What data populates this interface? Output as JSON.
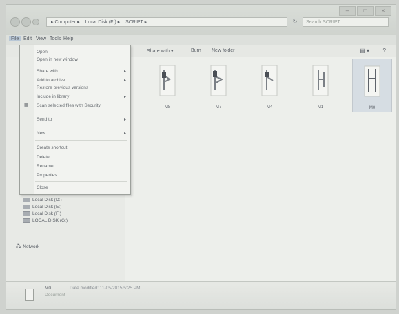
{
  "address": {
    "crumbs": [
      "▸ Computer ▸",
      "Local Disk (F:) ▸",
      "SCRIPT ▸"
    ],
    "search_placeholder": "Search SCRIPT"
  },
  "menubar": [
    "File",
    "Edit",
    "View",
    "Tools",
    "Help"
  ],
  "toolbar": [
    "Share with ▾",
    "Burn",
    "New folder"
  ],
  "file_menu": [
    {
      "label": "Open",
      "arrow": false
    },
    {
      "label": "Open in new window",
      "arrow": false
    },
    {
      "label": "Share with",
      "arrow": true
    },
    {
      "label": "Add to archive...",
      "arrow": true
    },
    {
      "label": "Restore previous versions",
      "arrow": false
    },
    {
      "label": "Include in library",
      "arrow": true
    },
    {
      "label": "Scan selected files with Security",
      "arrow": false
    },
    {
      "label": "Send to",
      "arrow": true
    },
    {
      "label": "New",
      "arrow": true
    },
    {
      "label": "Create shortcut",
      "arrow": false
    },
    {
      "label": "Delete",
      "arrow": false
    },
    {
      "label": "Rename",
      "arrow": false
    },
    {
      "label": "Properties",
      "arrow": false
    },
    {
      "label": "Close",
      "arrow": false
    }
  ],
  "files": [
    {
      "name": "M8"
    },
    {
      "name": "M7"
    },
    {
      "name": "M4"
    },
    {
      "name": "M1"
    },
    {
      "name": "M0"
    }
  ],
  "drives": [
    "Local Disk (D:)",
    "Local Disk (E:)",
    "Local Disk (F:)",
    "LOCAL DISK (G:)"
  ],
  "network": "Network",
  "details": {
    "name": "M0",
    "type": "Document",
    "date": "Date modified: 11-05-2015 5:25 PM"
  },
  "icons": {
    "back": "back-arrow-icon",
    "forward": "forward-arrow-icon",
    "refresh": "refresh-icon",
    "view": "view-options-icon",
    "help": "help-icon"
  }
}
